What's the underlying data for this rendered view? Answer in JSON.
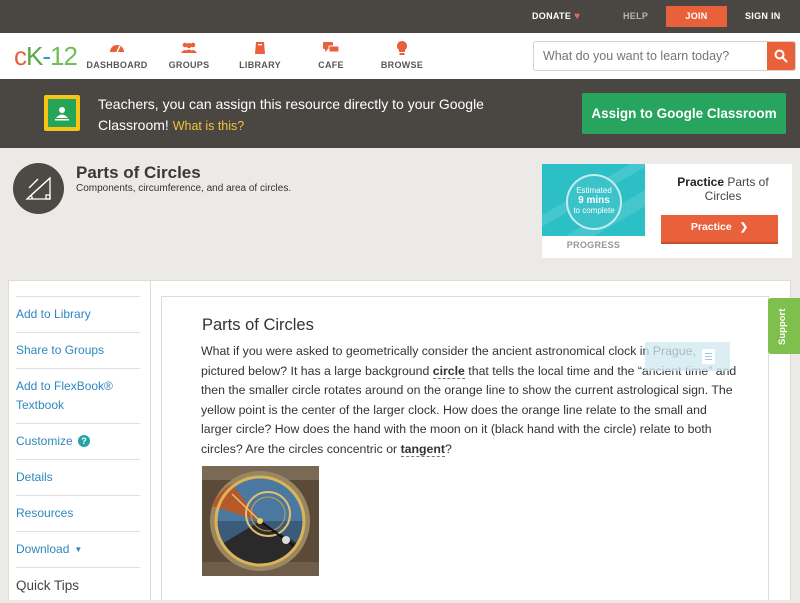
{
  "topbar": {
    "donate": "DONATE",
    "help": "HELP",
    "join": "JOIN",
    "signin": "SIGN IN"
  },
  "nav": {
    "items": [
      {
        "label": "DASHBOARD",
        "icon": "dashboard-icon"
      },
      {
        "label": "GROUPS",
        "icon": "groups-icon"
      },
      {
        "label": "LIBRARY",
        "icon": "library-icon"
      },
      {
        "label": "CAFE",
        "icon": "cafe-icon"
      },
      {
        "label": "BROWSE",
        "icon": "browse-icon"
      }
    ],
    "search_placeholder": "What do you want to learn today?"
  },
  "banner": {
    "text": "Teachers, you can assign this resource directly to your Google Classroom!",
    "what": "What is this?",
    "button": "Assign to Google Classroom"
  },
  "concept": {
    "title": "Parts of Circles",
    "subtitle": "Components, circumference, and area of circles."
  },
  "practice": {
    "estimated": "Estimated",
    "mins": "9 mins",
    "complete": "to complete",
    "progress_label": "PROGRESS",
    "title_bold": "Practice",
    "title_rest": "Parts of Circles",
    "button": "Practice"
  },
  "sidenav": {
    "items": [
      "Add to Library",
      "Share to Groups",
      "Add to FlexBook® Textbook",
      "Customize",
      "Details",
      "Resources",
      "Download"
    ],
    "quick_tips": "Quick Tips"
  },
  "content": {
    "title": "Parts of Circles",
    "p1": "What if you were asked to geometrically consider the ancient astronomical clock in Prague, pictured below? It has a large background ",
    "term1": "circle",
    "p2": " that tells the local time and the “ancient time” and then the smaller circle rotates around on the orange line to show the current astrological sign. The yellow point is the center of the larger clock. How does the orange line relate to the small and larger circle? How does the hand with the moon on it (black hand with the circle) relate to both circles? Are the circles concentric or ",
    "term2": "tangent",
    "p3": "?"
  },
  "support": "Support",
  "colors": {
    "accent": "#e8613a",
    "dark": "#4a4743",
    "green": "#27a45e",
    "link": "#2e88bd",
    "teal": "#2cc0c6"
  }
}
